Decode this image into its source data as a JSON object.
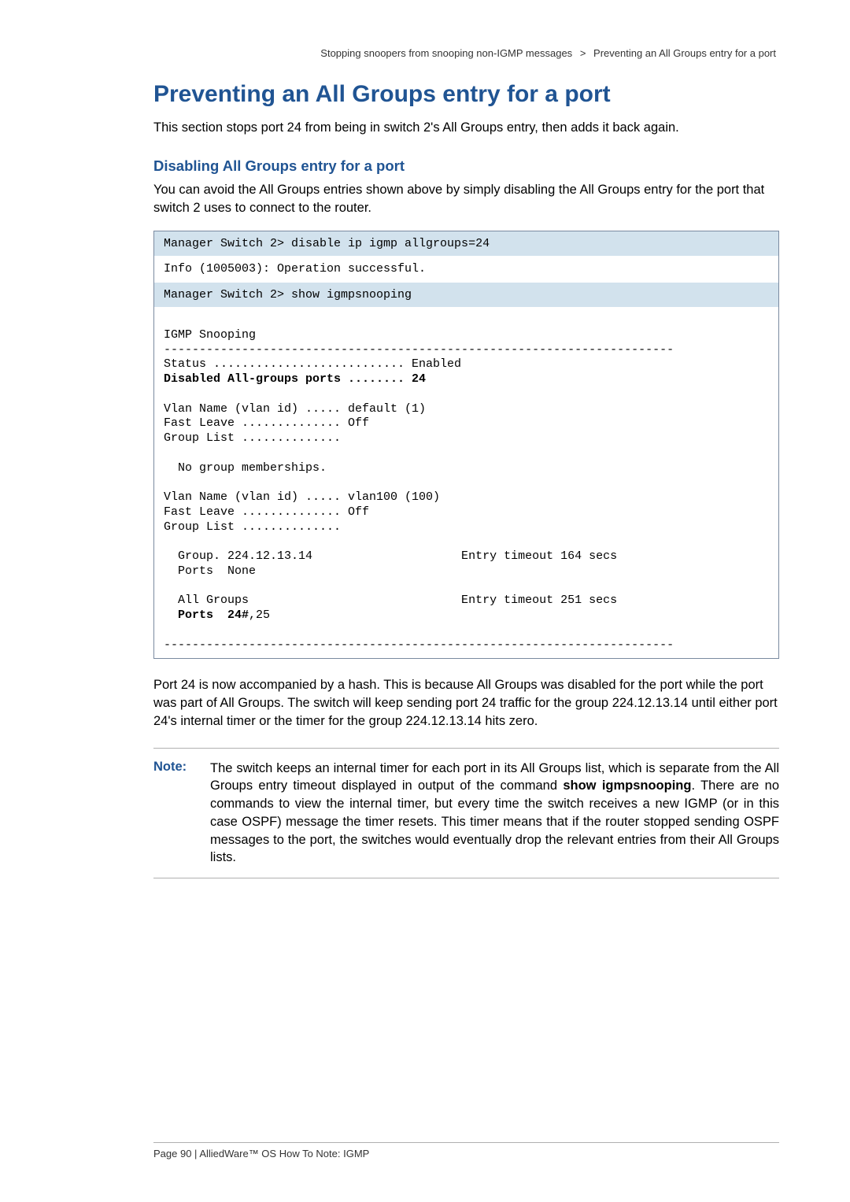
{
  "breadcrumb": {
    "part1": "Stopping snoopers from snooping non-IGMP messages",
    "sep": ">",
    "part2": "Preventing an All Groups entry for a port"
  },
  "title": "Preventing an All Groups entry for a port",
  "intro": "This section stops port 24 from being in switch 2's All Groups entry, then adds it back again.",
  "subheading": "Disabling All Groups entry for a port",
  "sub_intro": "You can avoid the All Groups entries shown above by simply disabling the All Groups entry for the port that switch 2 uses to connect to the router.",
  "terminal": {
    "cmd1": "Manager Switch 2> disable ip igmp allgroups=24",
    "out1": "Info (1005003): Operation successful.",
    "cmd2": "Manager Switch 2> show igmpsnooping",
    "out2_line1": "IGMP Snooping",
    "out2_dash1": "------------------------------------------------------------------------",
    "out2_status": "Status ........................... Enabled",
    "out2_disabled": "Disabled All-groups ports ........ 24",
    "out2_vlan1_name": "Vlan Name (vlan id) ..... default (1)",
    "out2_vlan1_fast": "Fast Leave .............. Off",
    "out2_vlan1_group": "Group List ..............",
    "out2_vlan1_nogroup": "  No group memberships.",
    "out2_vlan100_name": "Vlan Name (vlan id) ..... vlan100 (100)",
    "out2_vlan100_fast": "Fast Leave .............. Off",
    "out2_vlan100_group": "Group List ..............",
    "out2_group_entry": "  Group. 224.12.13.14                     Entry timeout 164 secs",
    "out2_group_ports": "  Ports  None",
    "out2_allgroups": "  All Groups                              Entry timeout 251 secs",
    "out2_allgroups_ports_prefix": "  Ports  24#",
    "out2_allgroups_ports_suffix": ",25",
    "out2_dash2": "------------------------------------------------------------------------"
  },
  "post_terminal": "Port 24 is now accompanied by a hash. This is because All Groups was disabled for the port while the port was part of All Groups. The switch will keep sending port 24 traffic for the group 224.12.13.14 until either port 24's internal timer or the timer for the group 224.12.13.14 hits zero.",
  "note": {
    "label": "Note:",
    "text_before_cmd": "The switch keeps an internal timer for each port in its All Groups list, which is separate from the All Groups entry timeout displayed in output of the command ",
    "cmd": "show igmpsnooping",
    "text_after_cmd": ". There are no commands to view the internal timer, but every time the switch receives a new IGMP (or in this case OSPF) message the timer resets. This timer means that if the router stopped sending OSPF messages to the port, the switches would eventually drop the relevant entries from their All Groups lists."
  },
  "footer": "Page 90 | AlliedWare™ OS How To Note: IGMP"
}
